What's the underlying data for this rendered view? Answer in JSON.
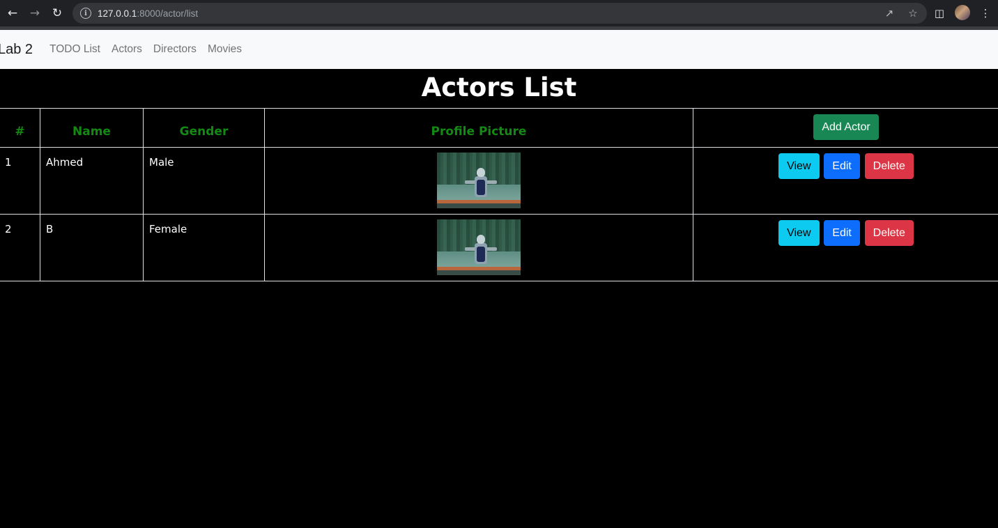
{
  "browser": {
    "url_host": "127.0.0.1",
    "url_path": ":8000/actor/list"
  },
  "navbar": {
    "brand": "Lab 2",
    "links": [
      "TODO List",
      "Actors",
      "Directors",
      "Movies"
    ]
  },
  "page": {
    "title": "Actors List"
  },
  "table": {
    "headers": {
      "num": "#",
      "name": "Name",
      "gender": "Gender",
      "picture": "Profile Picture"
    },
    "add_button": "Add Actor",
    "rows": [
      {
        "num": "1",
        "name": "Ahmed",
        "gender": "Male"
      },
      {
        "num": "2",
        "name": "B",
        "gender": "Female"
      }
    ],
    "actions": {
      "view": "View",
      "edit": "Edit",
      "delete": "Delete"
    }
  },
  "colors": {
    "header_text": "#138a13",
    "add_button": "#198754",
    "view_button": "#0dcaf0",
    "edit_button": "#0d6efd",
    "delete_button": "#dc3545"
  }
}
